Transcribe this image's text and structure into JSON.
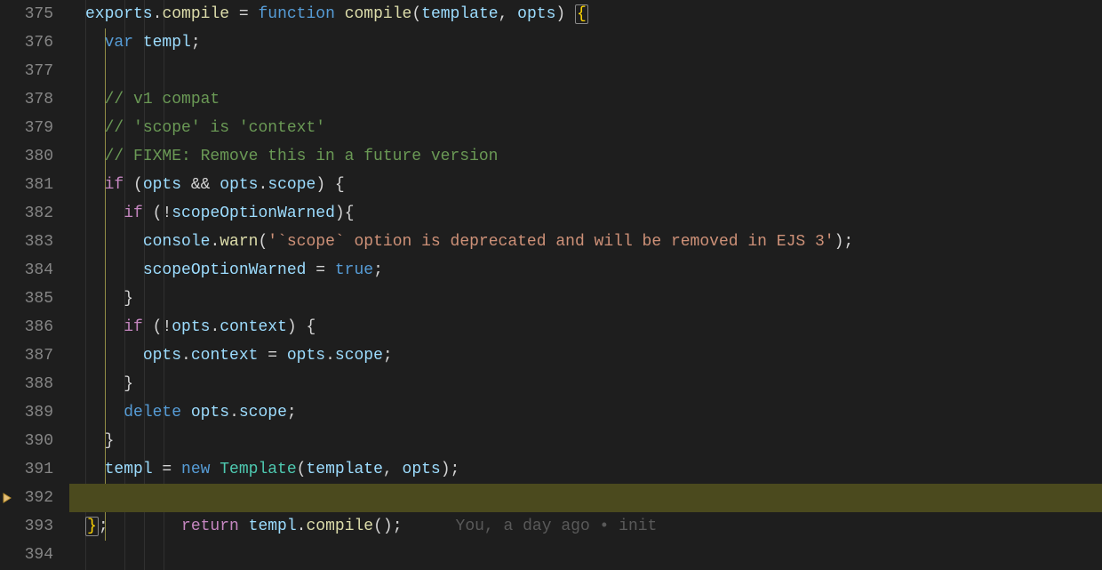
{
  "gutter": {
    "start": 375,
    "lines": [
      "375",
      "376",
      "377",
      "378",
      "379",
      "380",
      "381",
      "382",
      "383",
      "384",
      "385",
      "386",
      "387",
      "388",
      "389",
      "390",
      "391",
      "392",
      "393",
      "394"
    ]
  },
  "code": {
    "l375_exports": "exports",
    "l375_compileP": "compile",
    "l375_function": "function",
    "l375_compileF": "compile",
    "l375_template": "template",
    "l375_opts": "opts",
    "l376_var": "var",
    "l376_templ": "templ",
    "l378_cmt": "// v1 compat",
    "l379_cmt": "// 'scope' is 'context'",
    "l380_cmt": "// FIXME: Remove this in a future version",
    "l381_if": "if",
    "l381_opts": "opts",
    "l381_amp": "&&",
    "l381_opts2": "opts",
    "l381_scope": "scope",
    "l382_if": "if",
    "l382_not": "!",
    "l382_flag": "scopeOptionWarned",
    "l383_console": "console",
    "l383_warn": "warn",
    "l383_str": "'`scope` option is deprecated and will be removed in EJS 3'",
    "l384_flag": "scopeOptionWarned",
    "l384_true": "true",
    "l386_if": "if",
    "l386_not": "!",
    "l386_opts": "opts",
    "l386_context": "context",
    "l387_opts": "opts",
    "l387_context": "context",
    "l387_opts2": "opts",
    "l387_scope": "scope",
    "l389_delete": "delete",
    "l389_opts": "opts",
    "l389_scope": "scope",
    "l391_templ": "templ",
    "l391_new": "new",
    "l391_Template": "Template",
    "l391_template": "template",
    "l391_opts": "opts",
    "l392_return": "return",
    "l392_templ": "templ",
    "l392_compile": "compile",
    "l392_gitlens": "You, a day ago • init"
  }
}
